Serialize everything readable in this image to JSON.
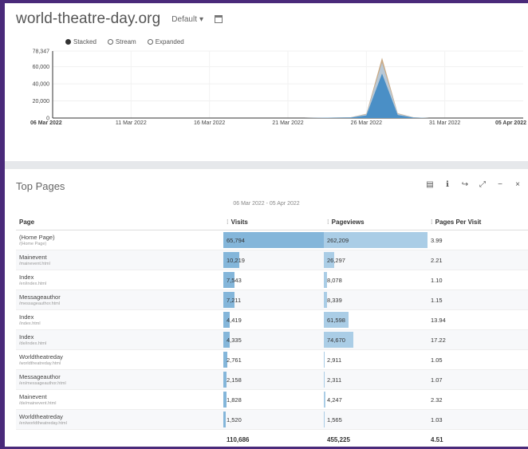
{
  "header": {
    "site": "world-theatre-day.org",
    "segment": "Default",
    "segment_caret": "▾"
  },
  "chart_data": {
    "type": "area",
    "legend": [
      "Stacked",
      "Stream",
      "Expanded"
    ],
    "legend_selected": "Stacked",
    "y_ticks": [
      "78,347",
      "60,000",
      "40,000",
      "20,000",
      "0"
    ],
    "y_max": 78347,
    "x_ticks": [
      "06 Mar 2022",
      "11 Mar 2022",
      "16 Mar 2022",
      "21 Mar 2022",
      "26 Mar 2022",
      "31 Mar 2022",
      "05 Apr 2022"
    ],
    "x_range": [
      "2022-03-06",
      "2022-04-05"
    ],
    "series": [
      {
        "name": "Visits",
        "color": "#4a8fc6",
        "points": [
          [
            "2022-03-06",
            0
          ],
          [
            "2022-03-22",
            0
          ],
          [
            "2022-03-25",
            600
          ],
          [
            "2022-03-26",
            3000
          ],
          [
            "2022-03-27",
            52000
          ],
          [
            "2022-03-28",
            3500
          ],
          [
            "2022-03-29",
            500
          ],
          [
            "2022-03-30",
            0
          ],
          [
            "2022-04-05",
            0
          ]
        ]
      },
      {
        "name": "Pageviews",
        "color": "#b8c8d6",
        "points": [
          [
            "2022-03-06",
            0
          ],
          [
            "2022-03-22",
            0
          ],
          [
            "2022-03-25",
            800
          ],
          [
            "2022-03-26",
            4500
          ],
          [
            "2022-03-27",
            65000
          ],
          [
            "2022-03-28",
            5000
          ],
          [
            "2022-03-29",
            800
          ],
          [
            "2022-03-30",
            0
          ],
          [
            "2022-04-05",
            0
          ]
        ]
      },
      {
        "name": "Pages Per Visit",
        "color": "#c9a882",
        "points": [
          [
            "2022-03-06",
            0
          ],
          [
            "2022-03-22",
            0
          ],
          [
            "2022-03-25",
            900
          ],
          [
            "2022-03-26",
            5000
          ],
          [
            "2022-03-27",
            70500
          ],
          [
            "2022-03-28",
            5600
          ],
          [
            "2022-03-29",
            900
          ],
          [
            "2022-03-30",
            0
          ],
          [
            "2022-04-05",
            0
          ]
        ]
      }
    ]
  },
  "top_pages": {
    "title": "Top Pages",
    "date_range": "06 Mar 2022 - 05 Apr 2022",
    "columns": [
      "Page",
      "Visits",
      "Pageviews",
      "Pages Per Visit"
    ],
    "rows": [
      {
        "name": "(Home Page)",
        "url": "/(Home Page)",
        "visits": "65,794",
        "visits_n": 65794,
        "pageviews": "262,209",
        "pageviews_n": 262209,
        "ppv": "3.99"
      },
      {
        "name": "Mainevent",
        "url": "/mainevent.html",
        "visits": "10,219",
        "visits_n": 10219,
        "pageviews": "26,297",
        "pageviews_n": 26297,
        "ppv": "2.21"
      },
      {
        "name": "Index",
        "url": "/en/index.html",
        "visits": "7,543",
        "visits_n": 7543,
        "pageviews": "8,078",
        "pageviews_n": 8078,
        "ppv": "1.10"
      },
      {
        "name": "Messageauthor",
        "url": "/messageauthor.html",
        "visits": "7,211",
        "visits_n": 7211,
        "pageviews": "8,339",
        "pageviews_n": 8339,
        "ppv": "1.15"
      },
      {
        "name": "Index",
        "url": "/index.html",
        "visits": "4,419",
        "visits_n": 4419,
        "pageviews": "61,598",
        "pageviews_n": 61598,
        "ppv": "13.94"
      },
      {
        "name": "Index",
        "url": "/de/index.html",
        "visits": "4,335",
        "visits_n": 4335,
        "pageviews": "74,670",
        "pageviews_n": 74670,
        "ppv": "17.22"
      },
      {
        "name": "Worldtheatreday",
        "url": "/worldtheatreday.html",
        "visits": "2,761",
        "visits_n": 2761,
        "pageviews": "2,911",
        "pageviews_n": 2911,
        "ppv": "1.05"
      },
      {
        "name": "Messageauthor",
        "url": "/en/messageauthor.html",
        "visits": "2,158",
        "visits_n": 2158,
        "pageviews": "2,311",
        "pageviews_n": 2311,
        "ppv": "1.07"
      },
      {
        "name": "Mainevent",
        "url": "/de/mainevent.html",
        "visits": "1,828",
        "visits_n": 1828,
        "pageviews": "4,247",
        "pageviews_n": 4247,
        "ppv": "2.32"
      },
      {
        "name": "Worldtheatreday",
        "url": "/en/worldtheatreday.html",
        "visits": "1,520",
        "visits_n": 1520,
        "pageviews": "1,565",
        "pageviews_n": 1565,
        "ppv": "1.03"
      }
    ],
    "totals": {
      "visits": "110,686",
      "pageviews": "455,225",
      "ppv": "4.51"
    }
  }
}
